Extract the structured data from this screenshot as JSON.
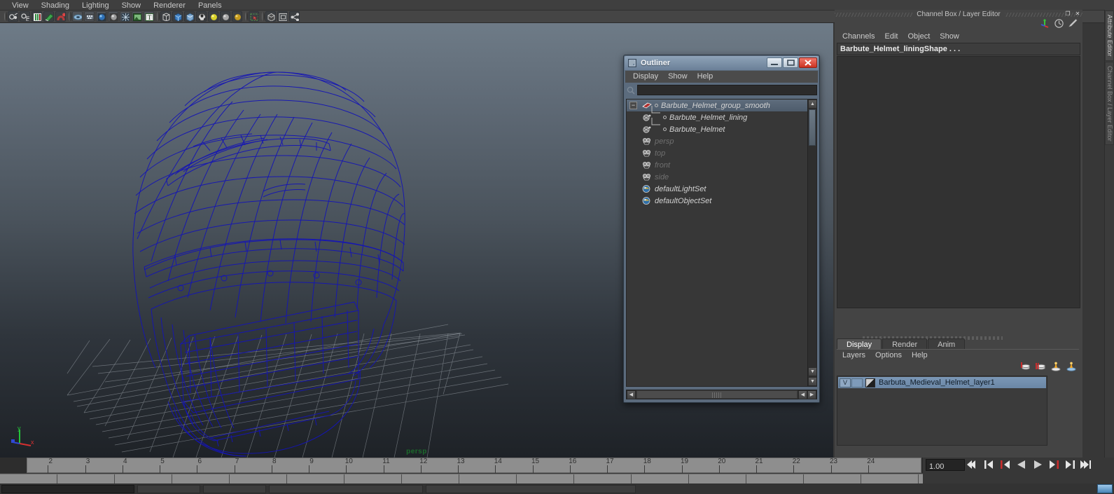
{
  "window": {
    "title": "Channel Box / Layer Editor",
    "controls": [
      "_",
      "❐",
      "✕"
    ]
  },
  "main_menu": {
    "items": [
      {
        "label": "View"
      },
      {
        "label": "Shading"
      },
      {
        "label": "Lighting"
      },
      {
        "label": "Show"
      },
      {
        "label": "Renderer"
      },
      {
        "label": "Panels"
      }
    ]
  },
  "toolbar": {
    "groups": [
      {
        "icons": [
          {
            "name": "select-by-object-icon",
            "glyph": "◉"
          },
          {
            "name": "select-by-component-icon",
            "glyph": "▣"
          },
          {
            "name": "highlight-selection-mode-icon",
            "glyph": "█"
          },
          {
            "name": "paint-selection-icon",
            "glyph": "◗"
          },
          {
            "name": "snap-magnet-icon",
            "glyph": "❀"
          }
        ]
      },
      {
        "icons": [
          {
            "name": "xray-shading-icon",
            "glyph": "⬭"
          },
          {
            "name": "texture-filter-icon",
            "glyph": "░"
          },
          {
            "name": "lighting-sphere-icon",
            "glyph": "●"
          },
          {
            "name": "shaded-sphere-icon",
            "glyph": "○"
          },
          {
            "name": "wireframe-shaded-icon",
            "glyph": "✶"
          },
          {
            "name": "texture-display-icon",
            "glyph": "⬛"
          },
          {
            "name": "text-display-icon",
            "glyph": "T"
          }
        ]
      },
      {
        "icons": [
          {
            "name": "isolate-select-icon",
            "glyph": "⬡"
          },
          {
            "name": "polygon-box-icon",
            "glyph": "⬛"
          },
          {
            "name": "smooth-shade-cube-icon",
            "glyph": "◻"
          },
          {
            "name": "wireframe-sphere-icon",
            "glyph": "⚽"
          },
          {
            "name": "light-default-icon",
            "glyph": "●"
          },
          {
            "name": "light-all-icon",
            "glyph": "●"
          },
          {
            "name": "light-shadow-icon",
            "glyph": "●"
          }
        ]
      },
      {
        "icons": [
          {
            "name": "grab-viewport-region-icon",
            "glyph": "⬚"
          }
        ]
      },
      {
        "icons": [
          {
            "name": "single-perspective-view-icon",
            "glyph": "⬛"
          },
          {
            "name": "four-view-layout-icon",
            "glyph": "▣"
          },
          {
            "name": "hypergraph-icon",
            "glyph": "⚯"
          }
        ]
      }
    ]
  },
  "viewport": {
    "camera_label": "persp",
    "axis": {
      "x": "x",
      "y": "y",
      "z": "z"
    },
    "wireframe_color": "#1515b4",
    "grid_color": "#aab1b8",
    "object": "Barbuta Medieval Helmet wireframe"
  },
  "outliner": {
    "title": "Outliner",
    "window_buttons": [
      {
        "name": "minimize-button",
        "glyph": "—"
      },
      {
        "name": "maximize-button",
        "glyph": "❐"
      },
      {
        "name": "close-button",
        "glyph": "✕"
      }
    ],
    "menus": [
      "Display",
      "Show",
      "Help"
    ],
    "search_value": "",
    "search_placeholder": "",
    "rows": [
      {
        "label": "Barbute_Helmet_group_smooth",
        "icon": "transform-group-icon",
        "indent": 0,
        "selected": true,
        "expander": "−",
        "dim": false,
        "dot": true
      },
      {
        "label": "Barbute_Helmet_lining",
        "icon": "mesh-node-icon",
        "indent": 1,
        "selected": false,
        "expander": "",
        "dim": false,
        "dot": true
      },
      {
        "label": "Barbute_Helmet",
        "icon": "mesh-node-icon",
        "indent": 1,
        "selected": false,
        "expander": "",
        "dim": false,
        "dot": true
      },
      {
        "label": "persp",
        "icon": "camera-icon",
        "indent": 0,
        "selected": false,
        "expander": "",
        "dim": true,
        "dot": false
      },
      {
        "label": "top",
        "icon": "camera-icon",
        "indent": 0,
        "selected": false,
        "expander": "",
        "dim": true,
        "dot": false
      },
      {
        "label": "front",
        "icon": "camera-icon",
        "indent": 0,
        "selected": false,
        "expander": "",
        "dim": true,
        "dot": false
      },
      {
        "label": "side",
        "icon": "camera-icon",
        "indent": 0,
        "selected": false,
        "expander": "",
        "dim": true,
        "dot": false
      },
      {
        "label": "defaultLightSet",
        "icon": "object-set-icon",
        "indent": 0,
        "selected": false,
        "expander": "",
        "dim": false,
        "dot": false
      },
      {
        "label": "defaultObjectSet",
        "icon": "object-set-icon",
        "indent": 0,
        "selected": false,
        "expander": "",
        "dim": false,
        "dot": false
      }
    ]
  },
  "channel_box": {
    "panel_title": "Channel Box / Layer Editor",
    "menus": [
      "Channels",
      "Edit",
      "Object",
      "Show"
    ],
    "node_name": "Barbute_Helmet_liningShape . . .",
    "tool_icons": [
      {
        "name": "channel-box-axis-icon"
      },
      {
        "name": "channel-box-clock-icon"
      },
      {
        "name": "channel-box-pen-icon"
      }
    ],
    "window_buttons": [
      {
        "name": "undock-button",
        "glyph": "❐"
      },
      {
        "name": "close-panel-button",
        "glyph": "✕"
      }
    ]
  },
  "layer_editor": {
    "tabs": [
      {
        "label": "Display",
        "active": true
      },
      {
        "label": "Render",
        "active": false
      },
      {
        "label": "Anim",
        "active": false
      }
    ],
    "menus": [
      "Layers",
      "Options",
      "Help"
    ],
    "toolbar_icons": [
      {
        "name": "create-empty-layer-icon"
      },
      {
        "name": "create-layer-from-selected-icon"
      },
      {
        "name": "layer-visibility-icon"
      },
      {
        "name": "layer-membership-icon"
      }
    ],
    "layers": [
      {
        "visibility": "V",
        "playback": "",
        "color_swatch": "#cfcfcf",
        "name": "Barbuta_Medieval_Helmet_layer1",
        "selected": true
      }
    ]
  },
  "right_vertical_tabs": [
    {
      "label": "Attribute Editor",
      "active": true
    },
    {
      "label": "Channel Box / Layer Editor",
      "active": false
    }
  ],
  "timeline": {
    "frames": [
      2,
      3,
      4,
      5,
      6,
      7,
      8,
      9,
      10,
      11,
      12,
      13,
      14,
      15,
      16,
      17,
      18,
      19,
      20,
      21,
      22,
      23,
      24
    ],
    "current_frame": "1.00",
    "playback_buttons": [
      {
        "name": "go-to-start-button",
        "glyph": "start"
      },
      {
        "name": "step-back-keyframe-button",
        "glyph": "prevkey"
      },
      {
        "name": "step-back-frame-button",
        "glyph": "prevframe"
      },
      {
        "name": "play-backwards-button",
        "glyph": "playback"
      },
      {
        "name": "play-forwards-button",
        "glyph": "playfwd"
      },
      {
        "name": "step-forward-frame-button",
        "glyph": "nextframe"
      },
      {
        "name": "step-forward-keyframe-button",
        "glyph": "nextkey"
      },
      {
        "name": "go-to-end-button",
        "glyph": "end"
      }
    ]
  },
  "colors": {
    "wireframe": "#1515b4",
    "accent_selected": "#6b87a6",
    "close_red": "#cc3322",
    "persp_green": "#1c6b2c"
  }
}
